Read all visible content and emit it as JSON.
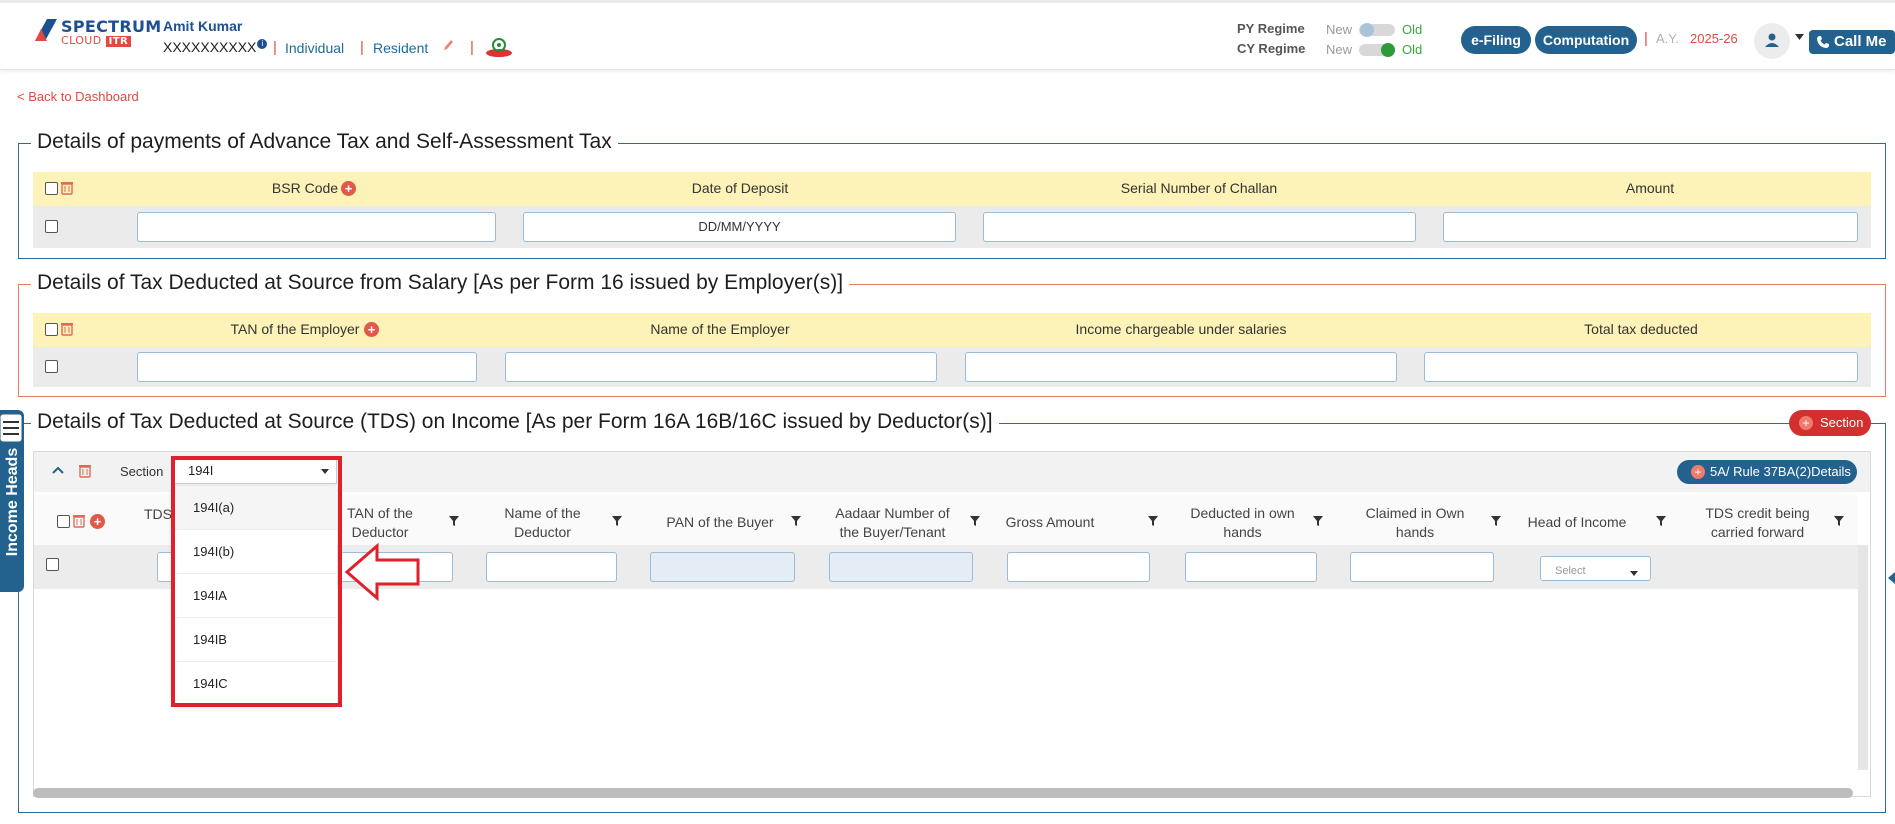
{
  "header": {
    "logo": {
      "line1": "SPECTRUM",
      "line2": "CLOUD",
      "badge": "ITR"
    },
    "user_name": "Amit Kumar",
    "pan": "XXXXXXXXXX",
    "status": "Individual",
    "residency": "Resident",
    "py_regime_label": "PY Regime",
    "cy_regime_label": "CY Regime",
    "new_label": "New",
    "old_label": "Old",
    "efiling_label": "e-Filing",
    "computation_label": "Computation",
    "ay_label": "A.Y.",
    "ay_value": "2025-26",
    "call_me_label": "Call Me"
  },
  "back_link": "< Back to Dashboard",
  "advance_tax": {
    "title": "Details of payments of Advance Tax and Self-Assessment Tax",
    "columns": [
      "BSR Code",
      "Date of Deposit",
      "Serial Number of Challan",
      "Amount"
    ],
    "date_placeholder": "DD/MM/YYYY"
  },
  "tds_salary": {
    "title": "Details of Tax Deducted at Source from Salary [As per Form 16 issued by Employer(s)]",
    "columns": [
      "TAN of the Employer",
      "Name of the Employer",
      "Income chargeable under salaries",
      "Total tax deducted"
    ]
  },
  "tds_income": {
    "title": "Details of Tax Deducted at Source (TDS) on Income [As per Form 16A 16B/16C issued by Deductor(s)]",
    "section_button": "Section",
    "rule_button": "5A/ Rule 37BA(2)Details",
    "section_label": "Section",
    "section_input": "194I",
    "dropdown_options": [
      "194I(a)",
      "194I(b)",
      "194IA",
      "194IB",
      "194IC"
    ],
    "columns": {
      "tds": "TDS",
      "tan_1": "TAN of the",
      "tan_2": "Deductor",
      "name_1": "Name of the",
      "name_2": "Deductor",
      "pan_buyer": "PAN of the Buyer",
      "aadhaar_1": "Aadaar Number of",
      "aadhaar_2": "the Buyer/Tenant",
      "gross": "Gross Amount",
      "ded_own_1": "Deducted in own",
      "ded_own_2": "hands",
      "claimed_1": "Claimed in Own",
      "claimed_2": "hands",
      "head": "Head of Income",
      "credit_1": "TDS credit being",
      "credit_2": "carried forward"
    },
    "select_placeholder": "Select"
  },
  "sidebar": {
    "label": "Income Heads"
  },
  "colors": {
    "brand_blue": "#23628f",
    "accent_red": "#e04a3f",
    "header_yellow": "#fdf2b7",
    "annotation_red": "#e0202a"
  },
  "icons": [
    "info-icon",
    "pencil-icon",
    "emblem-icon",
    "user-icon",
    "phone-icon",
    "trash-icon",
    "plus-icon",
    "filter-icon",
    "chevron-up-icon",
    "chevron-down-icon",
    "arrow-left-icon",
    "menu-icon"
  ]
}
